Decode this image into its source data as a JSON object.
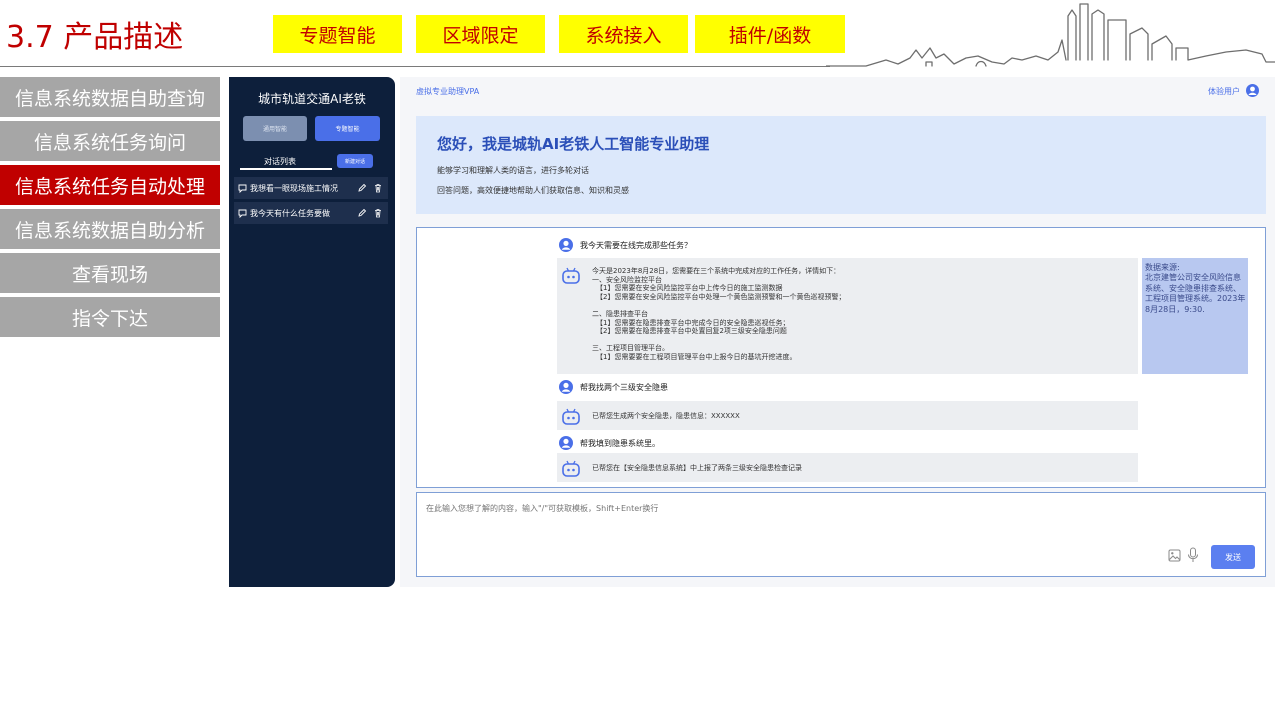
{
  "slide": {
    "title": "3.7 产品描述"
  },
  "top_buttons": [
    "专题智能",
    "区域限定",
    "系统接入",
    "插件/函数"
  ],
  "left_menu": {
    "items": [
      "信息系统数据自助查询",
      "信息系统任务询问",
      "信息系统任务自动处理",
      "信息系统数据自助分析",
      "查看现场",
      "指令下达"
    ],
    "active_index": 2
  },
  "sidebar": {
    "title": "城市轨道交通AI老铁",
    "mode_buttons": [
      "通用智能",
      "专题智能"
    ],
    "tab_label": "对话列表",
    "new_chat_label": "新建对话",
    "conversations": [
      "我想看一眼现场施工情况",
      "我今天有什么任务要做"
    ]
  },
  "app": {
    "name": "虚拟专业助理VPA",
    "user_label": "体验用户"
  },
  "welcome": {
    "title": "您好，我是城轨AI老铁人工智能专业助理",
    "lines": [
      "能够学习和理解人类的语言，进行多轮对话",
      "回答问题，高效便捷地帮助人们获取信息、知识和灵感"
    ]
  },
  "chat": {
    "q1": "我今天需要在线完成那些任务？",
    "a1_lines": [
      "今天是2023年8月28日，您需要在三个系统中完成对应的工作任务，详情如下：",
      "一、安全风险监控平台",
      "【1】您需要在安全风险监控平台中上传今日的施工监测数据",
      "【2】您需要在安全风险监控平台中处理一个黄色监测预警和一个黄色巡视预警；",
      "",
      "二、隐患排查平台",
      "【1】您需要在隐患排查平台中完成今日的安全隐患巡视任务；",
      "【2】您需要在隐患排查平台中处置回复2项三级安全隐患问题",
      "",
      "三、工程项目管理平台。",
      "【1】您需要要在工程项目管理平台中上报今日的基坑开挖进度。"
    ],
    "source": {
      "title": "数据来源:",
      "lines": [
        "北京建管公司安全风险信息",
        "系统、安全隐患排查系统、",
        "工程项目管理系统。2023年",
        "8月28日，9:30."
      ]
    },
    "q2": "帮我找两个三级安全隐患",
    "a2": "已帮您生成两个安全隐患，隐患信息：XXXXXX",
    "q3": "帮我填到隐患系统里。",
    "a3": "已帮您在【安全隐患信息系统】中上报了两条三级安全隐患检查记录"
  },
  "input": {
    "placeholder": "在此输入您想了解的内容，输入\"/\"可获取模板，Shift+Enter换行",
    "send_label": "发送"
  },
  "colors": {
    "title_red": "#c00000",
    "top_button_yellow": "#ffff00",
    "menu_grey": "#a6a6a6",
    "menu_active": "#c00000",
    "sidebar_navy": "#0d1f3b",
    "accent_blue": "#4a6fe8"
  }
}
